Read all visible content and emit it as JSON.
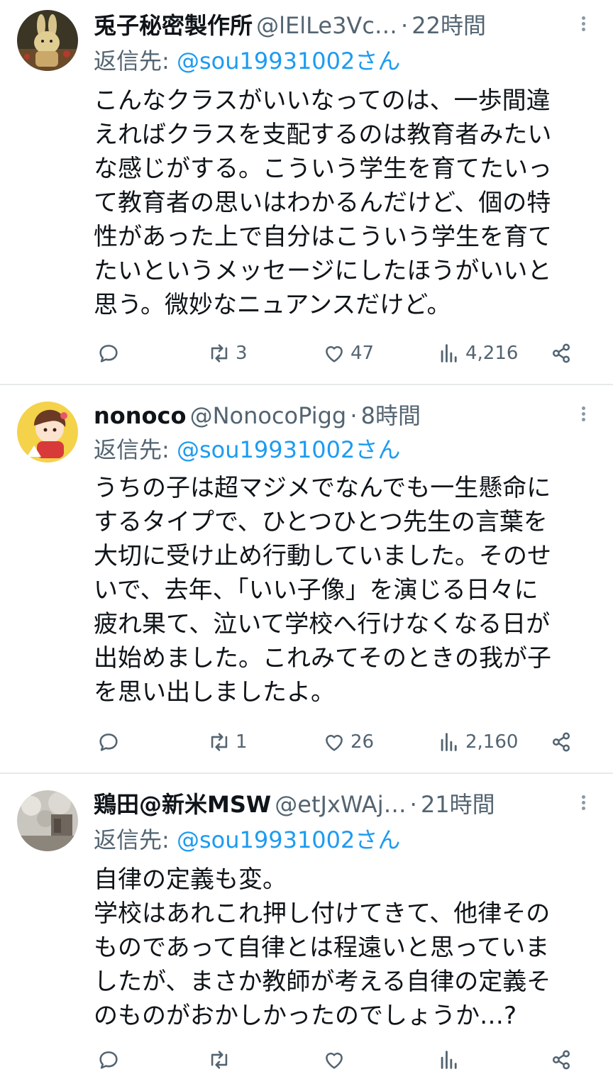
{
  "tweets": [
    {
      "name": "兎子秘密製作所",
      "handle": "@lElLe3Vc…",
      "dot": "·",
      "time": "22時間",
      "reply_prefix": "返信先: ",
      "reply_to": "@sou19931002さん",
      "text": "こんなクラスがいいなってのは、一歩間違\nえればクラスを支配するのは教育者みたい\nな感じがする。こういう学生を育てたいっ\nて教育者の思いはわかるんだけど、個の特\n性があった上で自分はこういう学生を育て\nたいというメッセージにしたほうがいいと\n思う。微妙なニュアンスだけど。",
      "retweets": "3",
      "likes": "47",
      "views": "4,216"
    },
    {
      "name": "nonoco",
      "handle": "@NonocoPigg",
      "dot": "·",
      "time": "8時間",
      "reply_prefix": "返信先: ",
      "reply_to": "@sou19931002さん",
      "text": "うちの子は超マジメでなんでも一生懸命に\nするタイプで、ひとつひとつ先生の言葉を\n大切に受け止め行動していました。そのせ\nいで、去年、「いい子像」を演じる日々に\n疲れ果て、泣いて学校へ行けなくなる日が\n出始めました。これみてそのときの我が子\nを思い出しましたよ。",
      "retweets": "1",
      "likes": "26",
      "views": "2,160"
    },
    {
      "name": "鶏田@新米MSW",
      "handle": "@etJxWAj…",
      "dot": "·",
      "time": "21時間",
      "reply_prefix": "返信先: ",
      "reply_to": "@sou19931002さん",
      "text": "自律の定義も変。\n学校はあれこれ押し付けてきて、他律その\nものであって自律とは程遠いと思っていま\nしたが、まさか教師が考える自律の定義そ\nのものがおかしかったのでしょうか…?",
      "retweets": "",
      "likes": "",
      "views": ""
    }
  ],
  "colors": {
    "text": "#0f1419",
    "secondary": "#536471",
    "link": "#1d9bf0",
    "divider": "#e7e9ea"
  },
  "icons": {
    "reply": "reply-icon",
    "retweet": "retweet-icon",
    "like": "heart-icon",
    "views": "views-icon",
    "share": "share-icon",
    "more": "more-icon"
  }
}
